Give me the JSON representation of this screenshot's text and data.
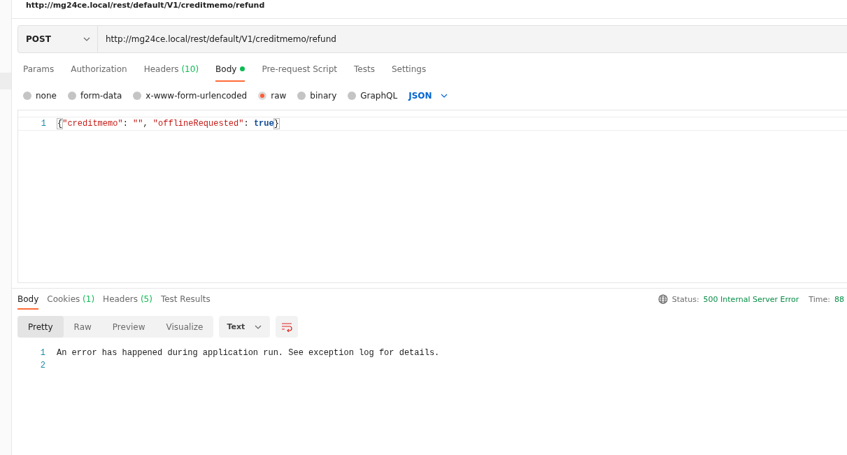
{
  "request_title": "http://mg24ce.local/rest/default/V1/creditmemo/refund",
  "method": "POST",
  "url": "http://mg24ce.local/rest/default/V1/creditmemo/refund",
  "request_tabs": [
    {
      "label": "Params",
      "selected": false
    },
    {
      "label": "Authorization",
      "selected": false
    },
    {
      "label": "Headers",
      "count": "(10)",
      "selected": false
    },
    {
      "label": "Body",
      "has_content": true,
      "selected": true
    },
    {
      "label": "Pre-request Script",
      "selected": false
    },
    {
      "label": "Tests",
      "selected": false
    },
    {
      "label": "Settings",
      "selected": false
    }
  ],
  "body_types": [
    {
      "label": "none",
      "selected": false
    },
    {
      "label": "form-data",
      "selected": false
    },
    {
      "label": "x-www-form-urlencoded",
      "selected": false
    },
    {
      "label": "raw",
      "selected": true
    },
    {
      "label": "binary",
      "selected": false
    },
    {
      "label": "GraphQL",
      "selected": false
    }
  ],
  "raw_format": "JSON",
  "editor_lines": [
    {
      "number": "1",
      "tokens": [
        {
          "kind": "brace",
          "text": "{"
        },
        {
          "kind": "key",
          "text": "\"creditmemo\""
        },
        {
          "kind": "punct",
          "text": ": "
        },
        {
          "kind": "string",
          "text": "\"\""
        },
        {
          "kind": "punct",
          "text": ", "
        },
        {
          "kind": "key",
          "text": "\"offlineRequested\""
        },
        {
          "kind": "punct",
          "text": ": "
        },
        {
          "kind": "bool",
          "text": "true"
        },
        {
          "kind": "brace",
          "text": "}"
        }
      ]
    }
  ],
  "response_tabs": [
    {
      "label": "Body",
      "selected": true
    },
    {
      "label": "Cookies",
      "count": "(1)",
      "selected": false
    },
    {
      "label": "Headers",
      "count": "(5)",
      "selected": false
    },
    {
      "label": "Test Results",
      "selected": false
    }
  ],
  "status_label": "Status:",
  "status": "500 Internal Server Error",
  "time_label": "Time:",
  "time": "88",
  "view_modes": [
    {
      "label": "Pretty",
      "selected": true
    },
    {
      "label": "Raw",
      "selected": false
    },
    {
      "label": "Preview",
      "selected": false
    },
    {
      "label": "Visualize",
      "selected": false
    }
  ],
  "response_format": "Text",
  "output_lines": [
    {
      "number": "1",
      "text": "An error has happened during application run. See exception log for details."
    },
    {
      "number": "2"
    }
  ]
}
